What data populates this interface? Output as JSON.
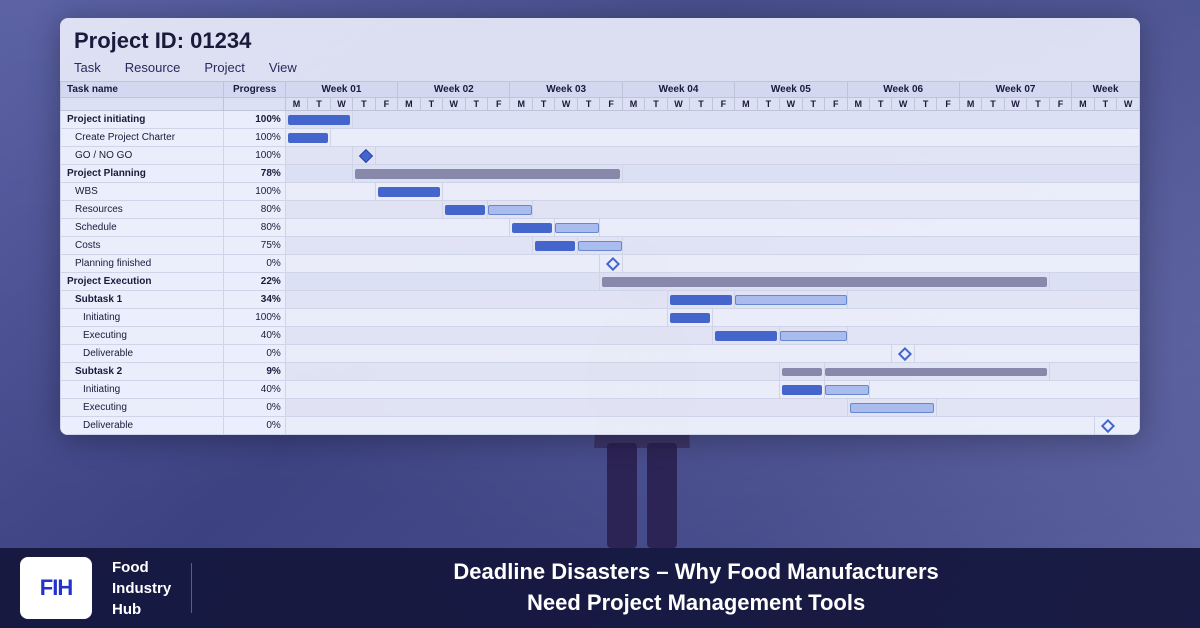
{
  "project": {
    "id_label": "Project ID: 01234",
    "menu": [
      "Task",
      "Resource",
      "Project",
      "View"
    ]
  },
  "gantt": {
    "col_headers": [
      "Task name",
      "Progress"
    ],
    "weeks": [
      "Week 01",
      "Week 02",
      "Week 03",
      "Week 04",
      "Week 05",
      "Week 06",
      "Week 07",
      "Week"
    ],
    "days": [
      "M",
      "T",
      "W",
      "T",
      "F",
      "M",
      "T",
      "W",
      "T",
      "F",
      "M",
      "T",
      "W",
      "T",
      "F",
      "M",
      "T",
      "W",
      "T",
      "F",
      "M",
      "T",
      "W",
      "T",
      "F",
      "M",
      "T",
      "W",
      "T",
      "F",
      "M",
      "T",
      "W",
      "T",
      "F",
      "M",
      "T",
      "W"
    ],
    "rows": [
      {
        "name": "Project initiating",
        "progress": "100%",
        "level": "bold"
      },
      {
        "name": "Create Project Charter",
        "progress": "100%",
        "level": "sub"
      },
      {
        "name": "GO / NO GO",
        "progress": "100%",
        "level": "sub"
      },
      {
        "name": "Project Planning",
        "progress": "78%",
        "level": "bold"
      },
      {
        "name": "WBS",
        "progress": "100%",
        "level": "sub"
      },
      {
        "name": "Resources",
        "progress": "80%",
        "level": "sub"
      },
      {
        "name": "Schedule",
        "progress": "80%",
        "level": "sub"
      },
      {
        "name": "Costs",
        "progress": "75%",
        "level": "sub"
      },
      {
        "name": "Planning finished",
        "progress": "0%",
        "level": "sub"
      },
      {
        "name": "Project Execution",
        "progress": "22%",
        "level": "bold"
      },
      {
        "name": "Subtask 1",
        "progress": "34%",
        "level": "sub-bold"
      },
      {
        "name": "Initiating",
        "progress": "100%",
        "level": "sub2"
      },
      {
        "name": "Executing",
        "progress": "40%",
        "level": "sub2"
      },
      {
        "name": "Deliverable",
        "progress": "0%",
        "level": "sub2"
      },
      {
        "name": "Subtask 2",
        "progress": "9%",
        "level": "sub-bold"
      },
      {
        "name": "Initiating",
        "progress": "40%",
        "level": "sub2"
      },
      {
        "name": "Executing",
        "progress": "0%",
        "level": "sub2"
      },
      {
        "name": "Deliverable",
        "progress": "0%",
        "level": "sub2"
      }
    ]
  },
  "bottom_bar": {
    "logo": "FIH",
    "company_line1": "Food",
    "company_line2": "Industry",
    "company_line3": "Hub",
    "headline_line1": "Deadline Disasters – Why Food Manufacturers",
    "headline_line2": "Need Project Management Tools"
  }
}
